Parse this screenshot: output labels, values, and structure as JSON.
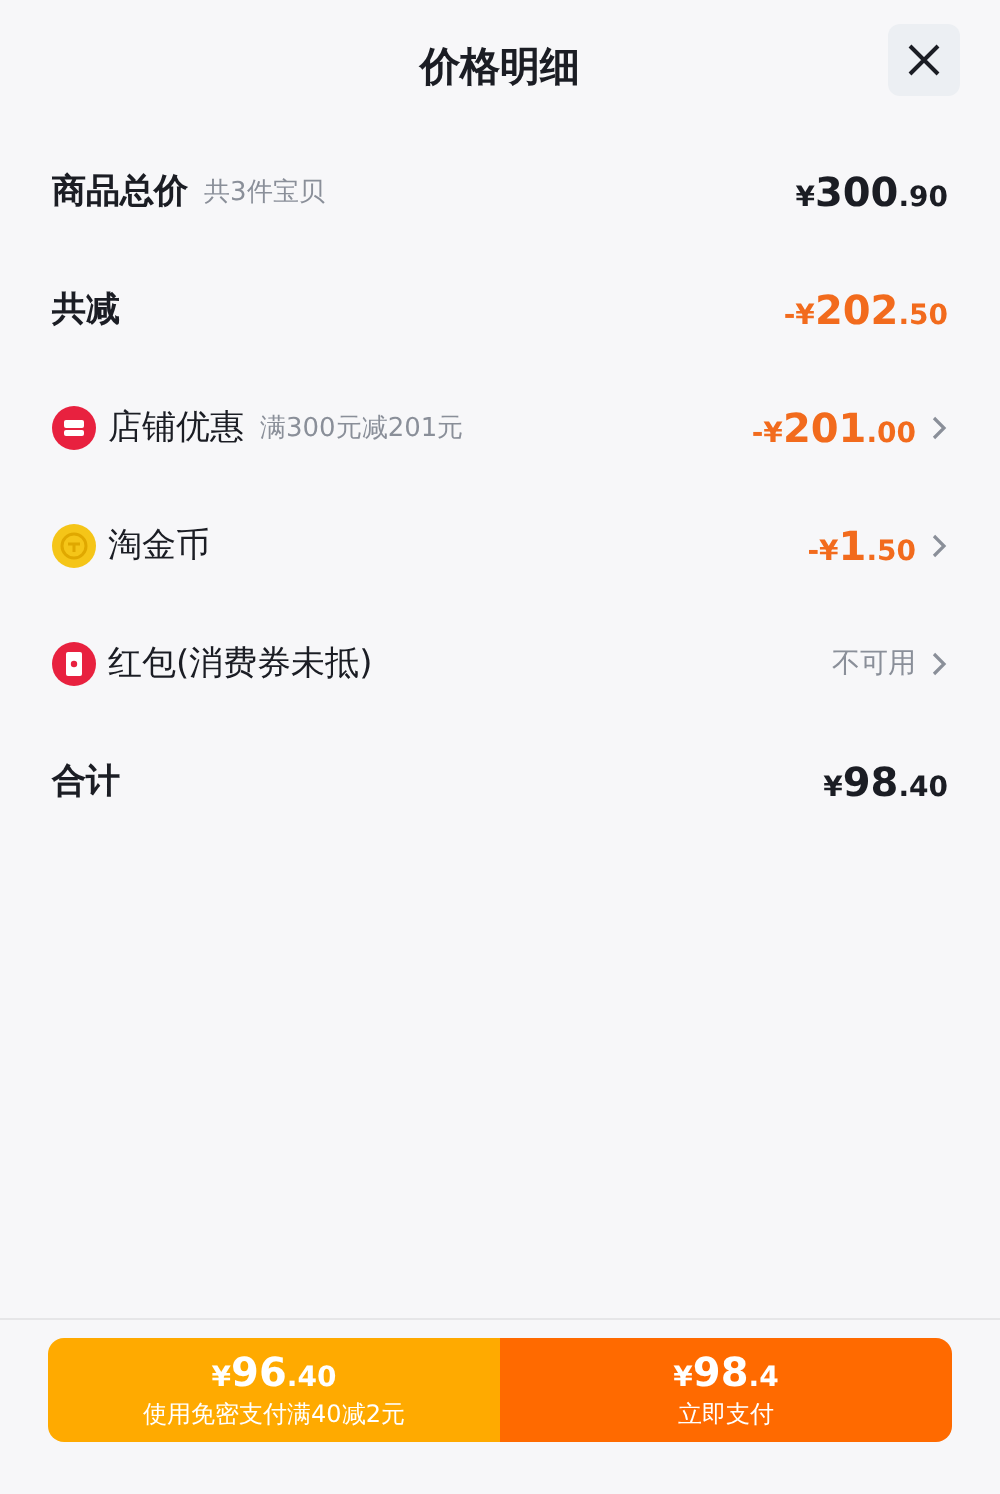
{
  "title": "价格明细",
  "rows": [
    {
      "kind": "plain",
      "label": "商品总价",
      "note": "共3件宝贝",
      "amount": {
        "sign": "¥",
        "whole": "300",
        "fraction": ".90"
      },
      "color": "#1b1d24",
      "chevron": false
    },
    {
      "kind": "plain",
      "label": "共减",
      "amount": {
        "sign": "-¥",
        "whole": "202",
        "fraction": ".50"
      },
      "color": "#f26b1d",
      "chevron": false
    },
    {
      "kind": "store",
      "label": "店铺优惠",
      "note": "满300元减201元",
      "amount": {
        "sign": "-¥",
        "whole": "201",
        "fraction": ".00"
      },
      "color": "#f26b1d",
      "chevron": true
    },
    {
      "kind": "coin",
      "label": "淘金币",
      "amount": {
        "sign": "-¥",
        "whole": "1",
        "fraction": ".50"
      },
      "color": "#f26b1d",
      "chevron": true
    },
    {
      "kind": "redpacket",
      "label": "红包(消费券未抵)",
      "status": "不可用",
      "chevron": true
    },
    {
      "kind": "plain",
      "label": "合计",
      "amount": {
        "sign": "¥",
        "whole": "98",
        "fraction": ".40"
      },
      "color": "#1b1d24",
      "chevron": false
    }
  ],
  "buttons": [
    {
      "kind": "secondary",
      "amount": {
        "sign": "¥",
        "whole": "96",
        "fraction": ".40"
      },
      "label": "使用免密支付满40减2元"
    },
    {
      "kind": "primary",
      "amount": {
        "sign": "¥",
        "whole": "98",
        "fraction": ".4"
      },
      "label": "立即支付"
    }
  ]
}
